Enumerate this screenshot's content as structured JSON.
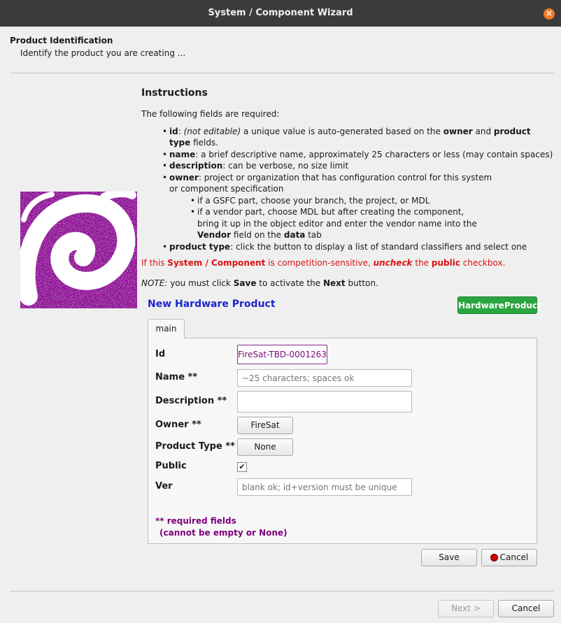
{
  "window": {
    "title": "System / Component Wizard",
    "close_icon": "×"
  },
  "header": {
    "title": "Product Identification",
    "subtitle": "Identify the product you are creating ..."
  },
  "instructions": {
    "title": "Instructions",
    "intro": "The following fields are required:",
    "id_name": "id",
    "id_not_editable": "(not editable)",
    "id_text1": " a unique value is auto-generated based on the ",
    "id_owner": "owner",
    "id_and": " and ",
    "id_product_type": "product type",
    "id_text2": " fields.",
    "name_name": "name",
    "name_text": ": a brief descriptive name, approximately 25 characters or less (may contain spaces)",
    "desc_name": "description",
    "desc_text": ": can be verbose, no size limit",
    "owner_name": "owner",
    "owner_text1": ": project or organization that has configuration control for this system",
    "owner_text2": "or component specification",
    "gsfc_text": "if a GSFC part, choose your branch, the project, or MDL",
    "vendor_text1": "if a vendor part, choose MDL but after creating the component,",
    "vendor_text2": "bring it up in the object editor and enter the vendor name into the",
    "vendor_field": "Vendor",
    "vendor_field_on": " field on the ",
    "vendor_data": "data",
    "vendor_tab": " tab",
    "pt_name": "product type",
    "pt_text": ": click the button to display a list of standard classifiers and select one",
    "comp_if": "If this ",
    "comp_sys": "System / Component",
    "comp_mid": " is competition-sensitive, ",
    "comp_uncheck": "uncheck",
    "comp_the": " the ",
    "comp_public": "public",
    "comp_end": " checkbox.",
    "note_label": "NOTE:",
    "note_text1": " you must click ",
    "note_save": "Save",
    "note_text2": " to activate the ",
    "note_next": "Next",
    "note_text3": " button."
  },
  "form": {
    "title": "New Hardware Product",
    "badge": "HardwareProduct",
    "tab_main": "main",
    "id_label": "Id",
    "id_value": "FireSat-TBD-0001263",
    "name_label": "Name **",
    "name_placeholder": "~25 characters; spaces ok",
    "description_label": "Description **",
    "description_value": "",
    "owner_label": "Owner **",
    "owner_value": "FireSat",
    "product_type_label": "Product Type **",
    "product_type_value": "None",
    "public_label": "Public",
    "public_checked": true,
    "check_mark": "✔",
    "ver_label": "Ver",
    "ver_placeholder": "blank ok; id+version must be unique",
    "req_note1": "** required fields",
    "req_note2": "(cannot be empty or None)",
    "save_label": "Save",
    "cancel_label": "Cancel"
  },
  "footer": {
    "next_label": "Next >",
    "cancel_label": "Cancel"
  },
  "colors": {
    "titlebar": "#3b3b3b",
    "logo_purple": "#8e1496",
    "form_title_blue": "#1a26d0",
    "badge_green": "#2aa640",
    "warning_red": "#dd1111",
    "required_purple": "#7c007c"
  }
}
